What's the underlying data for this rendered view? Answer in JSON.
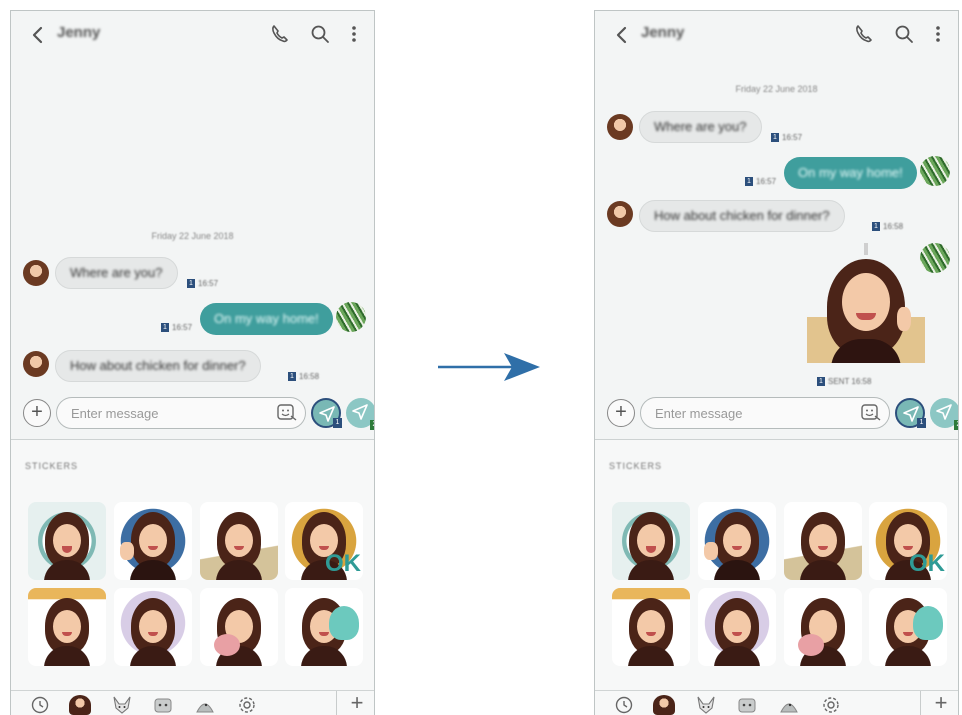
{
  "colors": {
    "accent": "#3f9e9d",
    "send_active_ring": "#2c4f7c",
    "sim1_badge": "#2c4f7c",
    "sim2_badge": "#2d7a3a",
    "arrow": "#2f6fa8"
  },
  "left_screen": {
    "header": {
      "back_icon": "chevron-left-icon",
      "contact_name": "Jenny",
      "call_icon": "phone-icon",
      "search_icon": "search-icon",
      "more_icon": "more-vertical-icon"
    },
    "date_label": "Friday 22 June 2018",
    "messages": [
      {
        "direction": "in",
        "text": "Where are you?",
        "sim": "1",
        "time": "16:57"
      },
      {
        "direction": "out",
        "text": "On my way home!",
        "sim": "1",
        "time": "16:57"
      },
      {
        "direction": "in",
        "text": "How about chicken for dinner?",
        "sim": "1",
        "time": "16:58"
      }
    ],
    "composer": {
      "placeholder": "Enter message",
      "send_sim_1": "1",
      "send_sim_2": "2"
    },
    "sticker_panel": {
      "title": "STICKERS",
      "tabs": [
        "clock-icon",
        "avatar-sticker-icon",
        "fox-sticker-icon",
        "cat-sticker-icon",
        "bird-sticker-icon",
        "settings-icon"
      ],
      "add_label": "+"
    }
  },
  "right_screen": {
    "header": {
      "contact_name": "Jenny"
    },
    "date_label": "Friday 22 June 2018",
    "messages": [
      {
        "direction": "in",
        "text": "Where are you?",
        "sim": "1",
        "time": "16:57"
      },
      {
        "direction": "out",
        "text": "On my way home!",
        "sim": "1",
        "time": "16:57"
      },
      {
        "direction": "in",
        "text": "How about chicken for dinner?",
        "sim": "1",
        "time": "16:58"
      },
      {
        "direction": "out",
        "type": "sticker",
        "sticker": "avatar-sticker-thumbs-up",
        "sim": "1",
        "time": "SENT 16:58"
      }
    ],
    "composer": {
      "placeholder": "Enter message",
      "send_sim_1": "1",
      "send_sim_2": "2"
    },
    "sticker_panel": {
      "title": "STICKERS",
      "add_label": "+"
    }
  }
}
